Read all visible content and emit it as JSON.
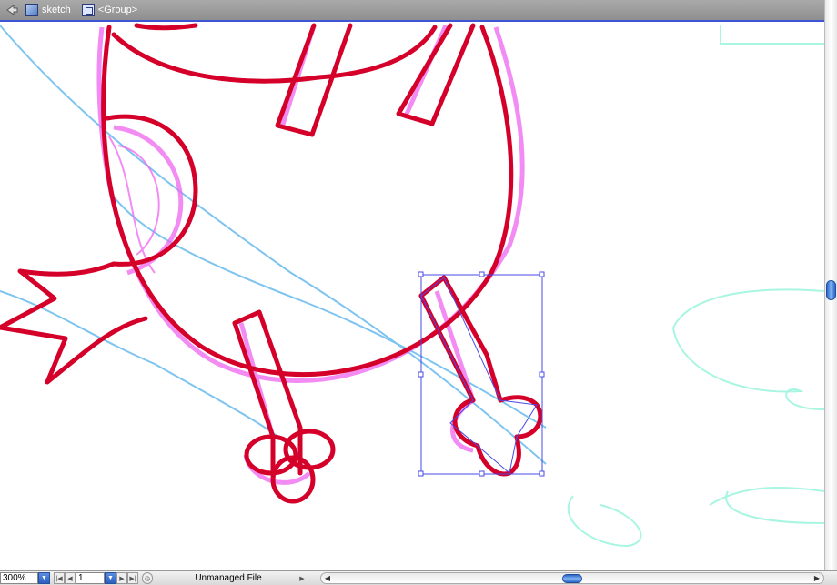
{
  "breadcrumb": {
    "layer_label": "sketch",
    "group_label": "<Group>"
  },
  "statusbar": {
    "zoom_value": "300%",
    "page_value": "1",
    "status_text": "Unmanaged File"
  },
  "colors": {
    "artwork_stroke": "#d4002a",
    "sketch_magenta": "#ee66f0",
    "guide_blue": "#7ec4f0",
    "guide_cyan": "#a8f5e2",
    "selection_blue": "#4a4ae8",
    "topbar_underline": "#3e55d6"
  },
  "icons": {
    "back": "back-arrow-icon",
    "layer": "layer-icon",
    "group": "group-icon"
  }
}
